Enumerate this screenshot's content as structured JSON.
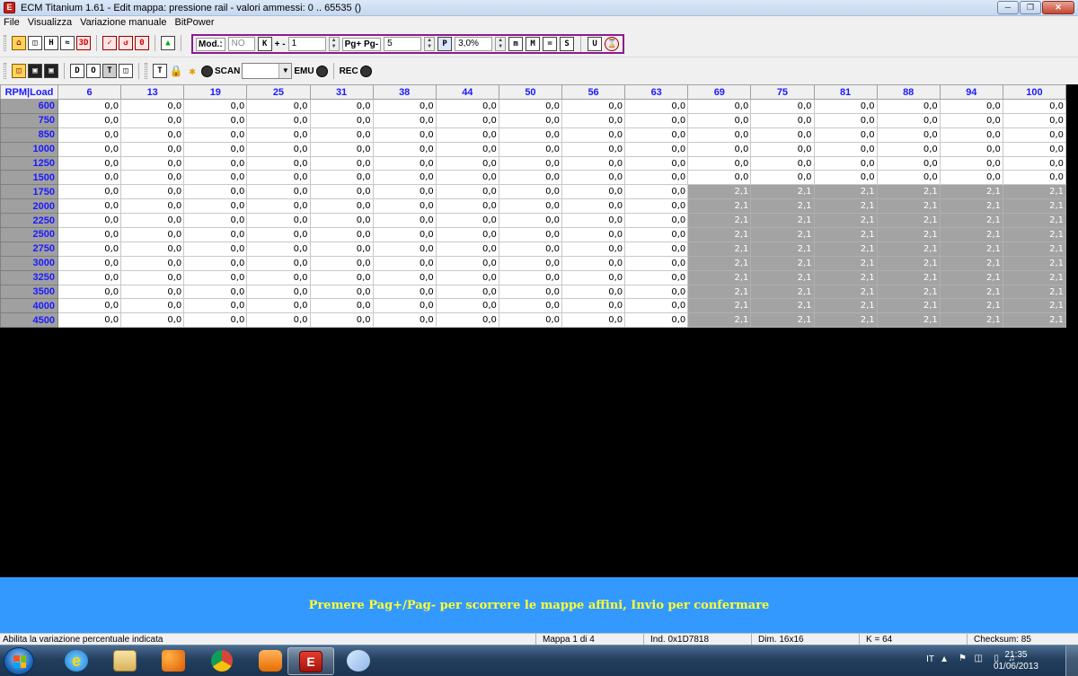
{
  "window": {
    "title": "ECM Titanium 1.61 - Edit mappa: pressione rail - valori ammessi: 0 .. 65535 ()",
    "controls": [
      "minimize-icon",
      "maximize-icon",
      "close-icon"
    ]
  },
  "menu": [
    "File",
    "Visualizza",
    "Variazione manuale",
    "BitPower"
  ],
  "toolbar": {
    "mod_label": "Mod.:",
    "mod_value": "NO",
    "k_label": "K",
    "step_label": "+ -",
    "step_value": "1",
    "page_label": "Pg+ Pg-",
    "page_value": "5",
    "p_label": "P",
    "percent_value": "3,0%",
    "scan_label": "SCAN",
    "emu_label": "EMU",
    "rec_label": "REC"
  },
  "grid": {
    "corner": "RPM|Load",
    "columns": [
      "6",
      "13",
      "19",
      "25",
      "31",
      "38",
      "44",
      "50",
      "56",
      "63",
      "69",
      "75",
      "81",
      "88",
      "94",
      "100"
    ],
    "rows": [
      {
        "rpm": "600",
        "values": [
          "0,0",
          "0,0",
          "0,0",
          "0,0",
          "0,0",
          "0,0",
          "0,0",
          "0,0",
          "0,0",
          "0,0",
          "0,0",
          "0,0",
          "0,0",
          "0,0",
          "0,0",
          "0,0"
        ]
      },
      {
        "rpm": "750",
        "values": [
          "0,0",
          "0,0",
          "0,0",
          "0,0",
          "0,0",
          "0,0",
          "0,0",
          "0,0",
          "0,0",
          "0,0",
          "0,0",
          "0,0",
          "0,0",
          "0,0",
          "0,0",
          "0,0"
        ]
      },
      {
        "rpm": "850",
        "values": [
          "0,0",
          "0,0",
          "0,0",
          "0,0",
          "0,0",
          "0,0",
          "0,0",
          "0,0",
          "0,0",
          "0,0",
          "0,0",
          "0,0",
          "0,0",
          "0,0",
          "0,0",
          "0,0"
        ]
      },
      {
        "rpm": "1000",
        "values": [
          "0,0",
          "0,0",
          "0,0",
          "0,0",
          "0,0",
          "0,0",
          "0,0",
          "0,0",
          "0,0",
          "0,0",
          "0,0",
          "0,0",
          "0,0",
          "0,0",
          "0,0",
          "0,0"
        ]
      },
      {
        "rpm": "1250",
        "values": [
          "0,0",
          "0,0",
          "0,0",
          "0,0",
          "0,0",
          "0,0",
          "0,0",
          "0,0",
          "0,0",
          "0,0",
          "0,0",
          "0,0",
          "0,0",
          "0,0",
          "0,0",
          "0,0"
        ]
      },
      {
        "rpm": "1500",
        "values": [
          "0,0",
          "0,0",
          "0,0",
          "0,0",
          "0,0",
          "0,0",
          "0,0",
          "0,0",
          "0,0",
          "0,0",
          "0,0",
          "0,0",
          "0,0",
          "0,0",
          "0,0",
          "0,0"
        ]
      },
      {
        "rpm": "1750",
        "values": [
          "0,0",
          "0,0",
          "0,0",
          "0,0",
          "0,0",
          "0,0",
          "0,0",
          "0,0",
          "0,0",
          "0,0",
          "2,1",
          "2,1",
          "2,1",
          "2,1",
          "2,1",
          "2,1"
        ]
      },
      {
        "rpm": "2000",
        "values": [
          "0,0",
          "0,0",
          "0,0",
          "0,0",
          "0,0",
          "0,0",
          "0,0",
          "0,0",
          "0,0",
          "0,0",
          "2,1",
          "2,1",
          "2,1",
          "2,1",
          "2,1",
          "2,1"
        ]
      },
      {
        "rpm": "2250",
        "values": [
          "0,0",
          "0,0",
          "0,0",
          "0,0",
          "0,0",
          "0,0",
          "0,0",
          "0,0",
          "0,0",
          "0,0",
          "2,1",
          "2,1",
          "2,1",
          "2,1",
          "2,1",
          "2,1"
        ]
      },
      {
        "rpm": "2500",
        "values": [
          "0,0",
          "0,0",
          "0,0",
          "0,0",
          "0,0",
          "0,0",
          "0,0",
          "0,0",
          "0,0",
          "0,0",
          "2,1",
          "2,1",
          "2,1",
          "2,1",
          "2,1",
          "2,1"
        ]
      },
      {
        "rpm": "2750",
        "values": [
          "0,0",
          "0,0",
          "0,0",
          "0,0",
          "0,0",
          "0,0",
          "0,0",
          "0,0",
          "0,0",
          "0,0",
          "2,1",
          "2,1",
          "2,1",
          "2,1",
          "2,1",
          "2,1"
        ]
      },
      {
        "rpm": "3000",
        "values": [
          "0,0",
          "0,0",
          "0,0",
          "0,0",
          "0,0",
          "0,0",
          "0,0",
          "0,0",
          "0,0",
          "0,0",
          "2,1",
          "2,1",
          "2,1",
          "2,1",
          "2,1",
          "2,1"
        ]
      },
      {
        "rpm": "3250",
        "values": [
          "0,0",
          "0,0",
          "0,0",
          "0,0",
          "0,0",
          "0,0",
          "0,0",
          "0,0",
          "0,0",
          "0,0",
          "2,1",
          "2,1",
          "2,1",
          "2,1",
          "2,1",
          "2,1"
        ]
      },
      {
        "rpm": "3500",
        "values": [
          "0,0",
          "0,0",
          "0,0",
          "0,0",
          "0,0",
          "0,0",
          "0,0",
          "0,0",
          "0,0",
          "0,0",
          "2,1",
          "2,1",
          "2,1",
          "2,1",
          "2,1",
          "2,1"
        ]
      },
      {
        "rpm": "4000",
        "values": [
          "0,0",
          "0,0",
          "0,0",
          "0,0",
          "0,0",
          "0,0",
          "0,0",
          "0,0",
          "0,0",
          "0,0",
          "2,1",
          "2,1",
          "2,1",
          "2,1",
          "2,1",
          "2,1"
        ]
      },
      {
        "rpm": "4500",
        "values": [
          "0,0",
          "0,0",
          "0,0",
          "0,0",
          "0,0",
          "0,0",
          "0,0",
          "0,0",
          "0,0",
          "0,0",
          "2,1",
          "2,1",
          "2,1",
          "2,1",
          "2,1",
          "2,1"
        ]
      }
    ],
    "highlight_value": "2,1",
    "highlight_color": "#a3a3a3"
  },
  "message": "Premere Pag+/Pag- per scorrere le mappe affini, Invio per confermare",
  "status": {
    "hint": "Abilita la variazione percentuale indicata",
    "map": "Mappa 1 di 4",
    "address": "Ind. 0x1D7818",
    "dim": "Dim. 16x16",
    "k": "K = 64",
    "checksum": "Checksum: 85"
  },
  "taskbar": {
    "apps": [
      "internet-explorer-icon",
      "explorer-icon",
      "paint-icon",
      "chrome-icon",
      "media-player-icon",
      "ecm-titanium-icon",
      "paintbrush-icon"
    ],
    "language": "IT",
    "time": "21:35",
    "date": "01/06/2013"
  },
  "colors": {
    "accent_blue": "#3399ff",
    "message_text": "#ffff33",
    "header_text": "#1a1aff",
    "mod_border": "#8c1b8c"
  }
}
